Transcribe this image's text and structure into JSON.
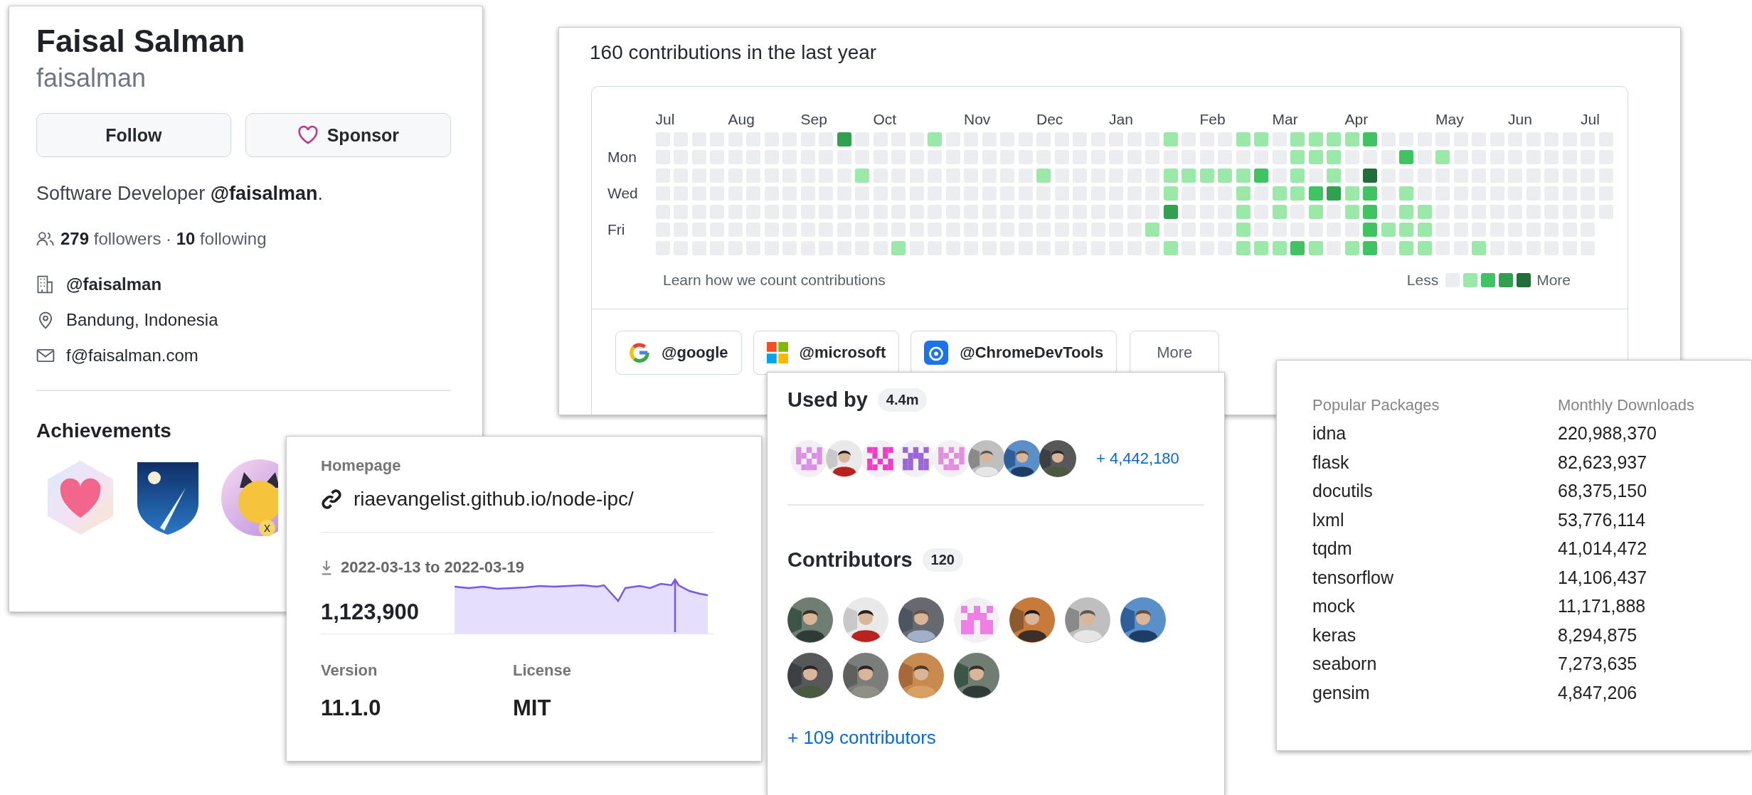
{
  "profile": {
    "name": "Faisal Salman",
    "username": "faisalman",
    "follow_button": "Follow",
    "sponsor_button": "Sponsor",
    "bio": "Software Developer **@faisalman**.",
    "followers": "**279** followers · **10** following",
    "details": [
      {
        "kind": "organization",
        "text": "@faisalman"
      },
      {
        "kind": "location",
        "text": "Bandung, Indonesia"
      },
      {
        "kind": "email",
        "text": "f@faisalman.com"
      }
    ],
    "achievements": {
      "title": "Achievements",
      "badges": [
        {
          "kind": "heart"
        },
        {
          "kind": "shield"
        },
        {
          "kind": "round",
          "count": "x"
        }
      ]
    }
  },
  "contributions": {
    "title": "160 contributions in the last year",
    "day_labels": [
      "Mon",
      "Wed",
      "Fri"
    ],
    "weeks": [
      {
        "month": "Jul",
        "days": [
          {
            "color": "#ebedf0"
          },
          {
            "color": "#ebedf0"
          },
          {
            "color": "#ebedf0"
          },
          {
            "color": "#ebedf0"
          },
          {
            "color": "#ebedf0"
          },
          {
            "color": "#ebedf0"
          },
          {
            "color": "#ebedf0"
          }
        ]
      },
      {
        "days": [
          {
            "color": "#ebedf0"
          },
          {
            "color": "#ebedf0"
          },
          {
            "color": "#ebedf0"
          },
          {
            "color": "#ebedf0"
          },
          {
            "color": "#ebedf0"
          },
          {
            "color": "#ebedf0"
          },
          {
            "color": "#ebedf0"
          }
        ]
      },
      {
        "days": [
          {
            "color": "#ebedf0"
          },
          {
            "color": "#ebedf0"
          },
          {
            "color": "#ebedf0"
          },
          {
            "color": "#ebedf0"
          },
          {
            "color": "#ebedf0"
          },
          {
            "color": "#ebedf0"
          },
          {
            "color": "#ebedf0"
          }
        ]
      },
      {
        "days": [
          {
            "color": "#ebedf0"
          },
          {
            "color": "#ebedf0"
          },
          {
            "color": "#ebedf0"
          },
          {
            "color": "#ebedf0"
          },
          {
            "color": "#ebedf0"
          },
          {
            "color": "#ebedf0"
          },
          {
            "color": "#ebedf0"
          }
        ]
      },
      {
        "month": "Aug",
        "days": [
          {
            "color": "#ebedf0"
          },
          {
            "color": "#ebedf0"
          },
          {
            "color": "#ebedf0"
          },
          {
            "color": "#ebedf0"
          },
          {
            "color": "#ebedf0"
          },
          {
            "color": "#ebedf0"
          },
          {
            "color": "#ebedf0"
          }
        ]
      },
      {
        "days": [
          {
            "color": "#ebedf0"
          },
          {
            "color": "#ebedf0"
          },
          {
            "color": "#ebedf0"
          },
          {
            "color": "#ebedf0"
          },
          {
            "color": "#ebedf0"
          },
          {
            "color": "#ebedf0"
          },
          {
            "color": "#ebedf0"
          }
        ]
      },
      {
        "days": [
          {
            "color": "#ebedf0"
          },
          {
            "color": "#ebedf0"
          },
          {
            "color": "#ebedf0"
          },
          {
            "color": "#ebedf0"
          },
          {
            "color": "#ebedf0"
          },
          {
            "color": "#ebedf0"
          },
          {
            "color": "#ebedf0"
          }
        ]
      },
      {
        "days": [
          {
            "color": "#ebedf0"
          },
          {
            "color": "#ebedf0"
          },
          {
            "color": "#ebedf0"
          },
          {
            "color": "#ebedf0"
          },
          {
            "color": "#ebedf0"
          },
          {
            "color": "#ebedf0"
          },
          {
            "color": "#ebedf0"
          }
        ]
      },
      {
        "month": "Sep",
        "days": [
          {
            "color": "#ebedf0"
          },
          {
            "color": "#ebedf0"
          },
          {
            "color": "#ebedf0"
          },
          {
            "color": "#ebedf0"
          },
          {
            "color": "#ebedf0"
          },
          {
            "color": "#ebedf0"
          },
          {
            "color": "#ebedf0"
          }
        ]
      },
      {
        "days": [
          {
            "color": "#ebedf0"
          },
          {
            "color": "#ebedf0"
          },
          {
            "color": "#ebedf0"
          },
          {
            "color": "#ebedf0"
          },
          {
            "color": "#ebedf0"
          },
          {
            "color": "#ebedf0"
          },
          {
            "color": "#ebedf0"
          }
        ]
      },
      {
        "days": [
          {
            "color": "#30a14e"
          },
          {
            "color": "#ebedf0"
          },
          {
            "color": "#ebedf0"
          },
          {
            "color": "#ebedf0"
          },
          {
            "color": "#ebedf0"
          },
          {
            "color": "#ebedf0"
          },
          {
            "color": "#ebedf0"
          }
        ]
      },
      {
        "days": [
          {
            "color": "#ebedf0"
          },
          {
            "color": "#ebedf0"
          },
          {
            "color": "#9be9a8"
          },
          {
            "color": "#ebedf0"
          },
          {
            "color": "#ebedf0"
          },
          {
            "color": "#ebedf0"
          },
          {
            "color": "#ebedf0"
          }
        ]
      },
      {
        "month": "Oct",
        "days": [
          {
            "color": "#ebedf0"
          },
          {
            "color": "#ebedf0"
          },
          {
            "color": "#ebedf0"
          },
          {
            "color": "#ebedf0"
          },
          {
            "color": "#ebedf0"
          },
          {
            "color": "#ebedf0"
          },
          {
            "color": "#ebedf0"
          }
        ]
      },
      {
        "days": [
          {
            "color": "#ebedf0"
          },
          {
            "color": "#ebedf0"
          },
          {
            "color": "#ebedf0"
          },
          {
            "color": "#ebedf0"
          },
          {
            "color": "#ebedf0"
          },
          {
            "color": "#ebedf0"
          },
          {
            "color": "#9be9a8"
          }
        ]
      },
      {
        "days": [
          {
            "color": "#ebedf0"
          },
          {
            "color": "#ebedf0"
          },
          {
            "color": "#ebedf0"
          },
          {
            "color": "#ebedf0"
          },
          {
            "color": "#ebedf0"
          },
          {
            "color": "#ebedf0"
          },
          {
            "color": "#ebedf0"
          }
        ]
      },
      {
        "days": [
          {
            "color": "#9be9a8"
          },
          {
            "color": "#ebedf0"
          },
          {
            "color": "#ebedf0"
          },
          {
            "color": "#ebedf0"
          },
          {
            "color": "#ebedf0"
          },
          {
            "color": "#ebedf0"
          },
          {
            "color": "#ebedf0"
          }
        ]
      },
      {
        "days": [
          {
            "color": "#ebedf0"
          },
          {
            "color": "#ebedf0"
          },
          {
            "color": "#ebedf0"
          },
          {
            "color": "#ebedf0"
          },
          {
            "color": "#ebedf0"
          },
          {
            "color": "#ebedf0"
          },
          {
            "color": "#ebedf0"
          }
        ]
      },
      {
        "month": "Nov",
        "days": [
          {
            "color": "#ebedf0"
          },
          {
            "color": "#ebedf0"
          },
          {
            "color": "#ebedf0"
          },
          {
            "color": "#ebedf0"
          },
          {
            "color": "#ebedf0"
          },
          {
            "color": "#ebedf0"
          },
          {
            "color": "#ebedf0"
          }
        ]
      },
      {
        "days": [
          {
            "color": "#ebedf0"
          },
          {
            "color": "#ebedf0"
          },
          {
            "color": "#ebedf0"
          },
          {
            "color": "#ebedf0"
          },
          {
            "color": "#ebedf0"
          },
          {
            "color": "#ebedf0"
          },
          {
            "color": "#ebedf0"
          }
        ]
      },
      {
        "days": [
          {
            "color": "#ebedf0"
          },
          {
            "color": "#ebedf0"
          },
          {
            "color": "#ebedf0"
          },
          {
            "color": "#ebedf0"
          },
          {
            "color": "#ebedf0"
          },
          {
            "color": "#ebedf0"
          },
          {
            "color": "#ebedf0"
          }
        ]
      },
      {
        "days": [
          {
            "color": "#ebedf0"
          },
          {
            "color": "#ebedf0"
          },
          {
            "color": "#ebedf0"
          },
          {
            "color": "#ebedf0"
          },
          {
            "color": "#ebedf0"
          },
          {
            "color": "#ebedf0"
          },
          {
            "color": "#ebedf0"
          }
        ]
      },
      {
        "month": "Dec",
        "days": [
          {
            "color": "#ebedf0"
          },
          {
            "color": "#ebedf0"
          },
          {
            "color": "#9be9a8"
          },
          {
            "color": "#ebedf0"
          },
          {
            "color": "#ebedf0"
          },
          {
            "color": "#ebedf0"
          },
          {
            "color": "#ebedf0"
          }
        ]
      },
      {
        "days": [
          {
            "color": "#ebedf0"
          },
          {
            "color": "#ebedf0"
          },
          {
            "color": "#ebedf0"
          },
          {
            "color": "#ebedf0"
          },
          {
            "color": "#ebedf0"
          },
          {
            "color": "#ebedf0"
          },
          {
            "color": "#ebedf0"
          }
        ]
      },
      {
        "days": [
          {
            "color": "#ebedf0"
          },
          {
            "color": "#ebedf0"
          },
          {
            "color": "#ebedf0"
          },
          {
            "color": "#ebedf0"
          },
          {
            "color": "#ebedf0"
          },
          {
            "color": "#ebedf0"
          },
          {
            "color": "#ebedf0"
          }
        ]
      },
      {
        "days": [
          {
            "color": "#ebedf0"
          },
          {
            "color": "#ebedf0"
          },
          {
            "color": "#ebedf0"
          },
          {
            "color": "#ebedf0"
          },
          {
            "color": "#ebedf0"
          },
          {
            "color": "#ebedf0"
          },
          {
            "color": "#ebedf0"
          }
        ]
      },
      {
        "month": "Jan",
        "days": [
          {
            "color": "#ebedf0"
          },
          {
            "color": "#ebedf0"
          },
          {
            "color": "#ebedf0"
          },
          {
            "color": "#ebedf0"
          },
          {
            "color": "#ebedf0"
          },
          {
            "color": "#ebedf0"
          },
          {
            "color": "#ebedf0"
          }
        ]
      },
      {
        "days": [
          {
            "color": "#ebedf0"
          },
          {
            "color": "#ebedf0"
          },
          {
            "color": "#ebedf0"
          },
          {
            "color": "#ebedf0"
          },
          {
            "color": "#ebedf0"
          },
          {
            "color": "#ebedf0"
          },
          {
            "color": "#ebedf0"
          }
        ]
      },
      {
        "days": [
          {
            "color": "#ebedf0"
          },
          {
            "color": "#ebedf0"
          },
          {
            "color": "#ebedf0"
          },
          {
            "color": "#ebedf0"
          },
          {
            "color": "#ebedf0"
          },
          {
            "color": "#9be9a8"
          },
          {
            "color": "#ebedf0"
          }
        ]
      },
      {
        "days": [
          {
            "color": "#9be9a8"
          },
          {
            "color": "#ebedf0"
          },
          {
            "color": "#9be9a8"
          },
          {
            "color": "#9be9a8"
          },
          {
            "color": "#30a14e"
          },
          {
            "color": "#ebedf0"
          },
          {
            "color": "#9be9a8"
          }
        ]
      },
      {
        "days": [
          {
            "color": "#ebedf0"
          },
          {
            "color": "#ebedf0"
          },
          {
            "color": "#9be9a8"
          },
          {
            "color": "#ebedf0"
          },
          {
            "color": "#ebedf0"
          },
          {
            "color": "#ebedf0"
          },
          {
            "color": "#ebedf0"
          }
        ]
      },
      {
        "month": "Feb",
        "days": [
          {
            "color": "#ebedf0"
          },
          {
            "color": "#ebedf0"
          },
          {
            "color": "#9be9a8"
          },
          {
            "color": "#ebedf0"
          },
          {
            "color": "#ebedf0"
          },
          {
            "color": "#ebedf0"
          },
          {
            "color": "#ebedf0"
          }
        ]
      },
      {
        "days": [
          {
            "color": "#ebedf0"
          },
          {
            "color": "#ebedf0"
          },
          {
            "color": "#9be9a8"
          },
          {
            "color": "#ebedf0"
          },
          {
            "color": "#ebedf0"
          },
          {
            "color": "#ebedf0"
          },
          {
            "color": "#ebedf0"
          }
        ]
      },
      {
        "days": [
          {
            "color": "#9be9a8"
          },
          {
            "color": "#ebedf0"
          },
          {
            "color": "#9be9a8"
          },
          {
            "color": "#9be9a8"
          },
          {
            "color": "#9be9a8"
          },
          {
            "color": "#9be9a8"
          },
          {
            "color": "#9be9a8"
          }
        ]
      },
      {
        "days": [
          {
            "color": "#9be9a8"
          },
          {
            "color": "#ebedf0"
          },
          {
            "color": "#40c463"
          },
          {
            "color": "#ebedf0"
          },
          {
            "color": "#ebedf0"
          },
          {
            "color": "#ebedf0"
          },
          {
            "color": "#9be9a8"
          }
        ]
      },
      {
        "month": "Mar",
        "days": [
          {
            "color": "#ebedf0"
          },
          {
            "color": "#ebedf0"
          },
          {
            "color": "#ebedf0"
          },
          {
            "color": "#9be9a8"
          },
          {
            "color": "#9be9a8"
          },
          {
            "color": "#ebedf0"
          },
          {
            "color": "#9be9a8"
          }
        ]
      },
      {
        "days": [
          {
            "color": "#9be9a8"
          },
          {
            "color": "#9be9a8"
          },
          {
            "color": "#9be9a8"
          },
          {
            "color": "#9be9a8"
          },
          {
            "color": "#ebedf0"
          },
          {
            "color": "#ebedf0"
          },
          {
            "color": "#40c463"
          }
        ]
      },
      {
        "days": [
          {
            "color": "#9be9a8"
          },
          {
            "color": "#9be9a8"
          },
          {
            "color": "#ebedf0"
          },
          {
            "color": "#40c463"
          },
          {
            "color": "#9be9a8"
          },
          {
            "color": "#ebedf0"
          },
          {
            "color": "#9be9a8"
          }
        ]
      },
      {
        "days": [
          {
            "color": "#9be9a8"
          },
          {
            "color": "#9be9a8"
          },
          {
            "color": "#9be9a8"
          },
          {
            "color": "#30a14e"
          },
          {
            "color": "#ebedf0"
          },
          {
            "color": "#ebedf0"
          },
          {
            "color": "#ebedf0"
          }
        ]
      },
      {
        "month": "Apr",
        "days": [
          {
            "color": "#9be9a8"
          },
          {
            "color": "#ebedf0"
          },
          {
            "color": "#ebedf0"
          },
          {
            "color": "#9be9a8"
          },
          {
            "color": "#9be9a8"
          },
          {
            "color": "#ebedf0"
          },
          {
            "color": "#9be9a8"
          }
        ]
      },
      {
        "days": [
          {
            "color": "#40c463"
          },
          {
            "color": "#ebedf0"
          },
          {
            "color": "#216e39"
          },
          {
            "color": "#40c463"
          },
          {
            "color": "#40c463"
          },
          {
            "color": "#40c463"
          },
          {
            "color": "#40c463"
          }
        ]
      },
      {
        "days": [
          {
            "color": "#ebedf0"
          },
          {
            "color": "#ebedf0"
          },
          {
            "color": "#ebedf0"
          },
          {
            "color": "#ebedf0"
          },
          {
            "color": "#ebedf0"
          },
          {
            "color": "#9be9a8"
          },
          {
            "color": "#ebedf0"
          }
        ]
      },
      {
        "days": [
          {
            "color": "#ebedf0"
          },
          {
            "color": "#40c463"
          },
          {
            "color": "#ebedf0"
          },
          {
            "color": "#9be9a8"
          },
          {
            "color": "#9be9a8"
          },
          {
            "color": "#9be9a8"
          },
          {
            "color": "#9be9a8"
          }
        ]
      },
      {
        "days": [
          {
            "color": "#ebedf0"
          },
          {
            "color": "#ebedf0"
          },
          {
            "color": "#ebedf0"
          },
          {
            "color": "#ebedf0"
          },
          {
            "color": "#9be9a8"
          },
          {
            "color": "#9be9a8"
          },
          {
            "color": "#9be9a8"
          }
        ]
      },
      {
        "month": "May",
        "days": [
          {
            "color": "#ebedf0"
          },
          {
            "color": "#9be9a8"
          },
          {
            "color": "#ebedf0"
          },
          {
            "color": "#ebedf0"
          },
          {
            "color": "#ebedf0"
          },
          {
            "color": "#ebedf0"
          },
          {
            "color": "#ebedf0"
          }
        ]
      },
      {
        "days": [
          {
            "color": "#ebedf0"
          },
          {
            "color": "#ebedf0"
          },
          {
            "color": "#ebedf0"
          },
          {
            "color": "#ebedf0"
          },
          {
            "color": "#ebedf0"
          },
          {
            "color": "#ebedf0"
          },
          {
            "color": "#ebedf0"
          }
        ]
      },
      {
        "days": [
          {
            "color": "#ebedf0"
          },
          {
            "color": "#ebedf0"
          },
          {
            "color": "#ebedf0"
          },
          {
            "color": "#ebedf0"
          },
          {
            "color": "#ebedf0"
          },
          {
            "color": "#ebedf0"
          },
          {
            "color": "#9be9a8"
          }
        ]
      },
      {
        "days": [
          {
            "color": "#ebedf0"
          },
          {
            "color": "#ebedf0"
          },
          {
            "color": "#ebedf0"
          },
          {
            "color": "#ebedf0"
          },
          {
            "color": "#ebedf0"
          },
          {
            "color": "#ebedf0"
          },
          {
            "color": "#ebedf0"
          }
        ]
      },
      {
        "month": "Jun",
        "days": [
          {
            "color": "#ebedf0"
          },
          {
            "color": "#ebedf0"
          },
          {
            "color": "#ebedf0"
          },
          {
            "color": "#ebedf0"
          },
          {
            "color": "#ebedf0"
          },
          {
            "color": "#ebedf0"
          },
          {
            "color": "#ebedf0"
          }
        ]
      },
      {
        "days": [
          {
            "color": "#ebedf0"
          },
          {
            "color": "#ebedf0"
          },
          {
            "color": "#ebedf0"
          },
          {
            "color": "#ebedf0"
          },
          {
            "color": "#ebedf0"
          },
          {
            "color": "#ebedf0"
          },
          {
            "color": "#ebedf0"
          }
        ]
      },
      {
        "days": [
          {
            "color": "#ebedf0"
          },
          {
            "color": "#ebedf0"
          },
          {
            "color": "#ebedf0"
          },
          {
            "color": "#ebedf0"
          },
          {
            "color": "#ebedf0"
          },
          {
            "color": "#ebedf0"
          },
          {
            "color": "#ebedf0"
          }
        ]
      },
      {
        "days": [
          {
            "color": "#ebedf0"
          },
          {
            "color": "#ebedf0"
          },
          {
            "color": "#ebedf0"
          },
          {
            "color": "#ebedf0"
          },
          {
            "color": "#ebedf0"
          },
          {
            "color": "#ebedf0"
          },
          {
            "color": "#ebedf0"
          }
        ]
      },
      {
        "month": "Jul",
        "days": [
          {
            "color": "#ebedf0"
          },
          {
            "color": "#ebedf0"
          },
          {
            "color": "#ebedf0"
          },
          {
            "color": "#ebedf0"
          },
          {
            "color": "#ebedf0"
          },
          {
            "color": "#ebedf0"
          },
          {
            "color": "#ebedf0"
          }
        ]
      },
      {
        "days": [
          {
            "color": "#ebedf0"
          },
          {
            "color": "#ebedf0"
          },
          {
            "color": "#ebedf0"
          },
          {
            "color": "#ebedf0"
          },
          {
            "color": "#ebedf0"
          }
        ]
      }
    ],
    "learn_link": "Learn how we count contributions",
    "legend_less": "Less",
    "legend_more": "More",
    "organizations": [
      {
        "kind": "google",
        "label": "@google"
      },
      {
        "kind": "microsoft",
        "label": "@microsoft"
      },
      {
        "kind": "chrome-devtools",
        "label": "@ChromeDevTools"
      }
    ],
    "more_button": "More"
  },
  "package": {
    "homepage_label": "Homepage",
    "homepage_url": "riaevangelist.github.io/node-ipc/",
    "date_range": "2022-03-13 to 2022-03-19",
    "weekly_downloads": "1,123,900",
    "version_label": "Version",
    "version": "11.1.0",
    "license_label": "License",
    "license": "MIT"
  },
  "used_by": {
    "title": "Used by",
    "count": "4.4m",
    "avatars": [
      {
        "kind": "identicon",
        "color": "#dc8ee6"
      },
      {
        "kind": "picture"
      },
      {
        "kind": "identicon",
        "color": "#f03cc8"
      },
      {
        "kind": "identicon",
        "color": "#9a66d8"
      },
      {
        "kind": "identicon",
        "color": "#e48ee0"
      },
      {
        "kind": "picture"
      },
      {
        "kind": "picture"
      },
      {
        "kind": "picture"
      }
    ],
    "more_link": "+ 4,442,180"
  },
  "contributors": {
    "title": "Contributors",
    "count": "120",
    "avatars": [
      {
        "kind": "picture"
      },
      {
        "kind": "picture"
      },
      {
        "kind": "picture"
      },
      {
        "kind": "identicon",
        "color": "#f07ee6"
      },
      {
        "kind": "picture"
      },
      {
        "kind": "picture"
      },
      {
        "kind": "picture"
      },
      {
        "kind": "picture"
      },
      {
        "kind": "picture"
      },
      {
        "kind": "picture"
      },
      {
        "kind": "picture"
      }
    ],
    "more_link": "+ 109 contributors"
  },
  "popular_packages": {
    "columns": [
      "Popular Packages",
      "Monthly Downloads"
    ],
    "rows": [
      {
        "name": "idna",
        "downloads": "220,988,370"
      },
      {
        "name": "flask",
        "downloads": "82,623,937"
      },
      {
        "name": "docutils",
        "downloads": "68,375,150"
      },
      {
        "name": "lxml",
        "downloads": "53,776,114"
      },
      {
        "name": "tqdm",
        "downloads": "41,014,472"
      },
      {
        "name": "tensorflow",
        "downloads": "14,106,437"
      },
      {
        "name": "mock",
        "downloads": "11,171,888"
      },
      {
        "name": "keras",
        "downloads": "8,294,875"
      },
      {
        "name": "seaborn",
        "downloads": "7,273,635"
      },
      {
        "name": "gensim",
        "downloads": "4,847,206"
      }
    ]
  }
}
